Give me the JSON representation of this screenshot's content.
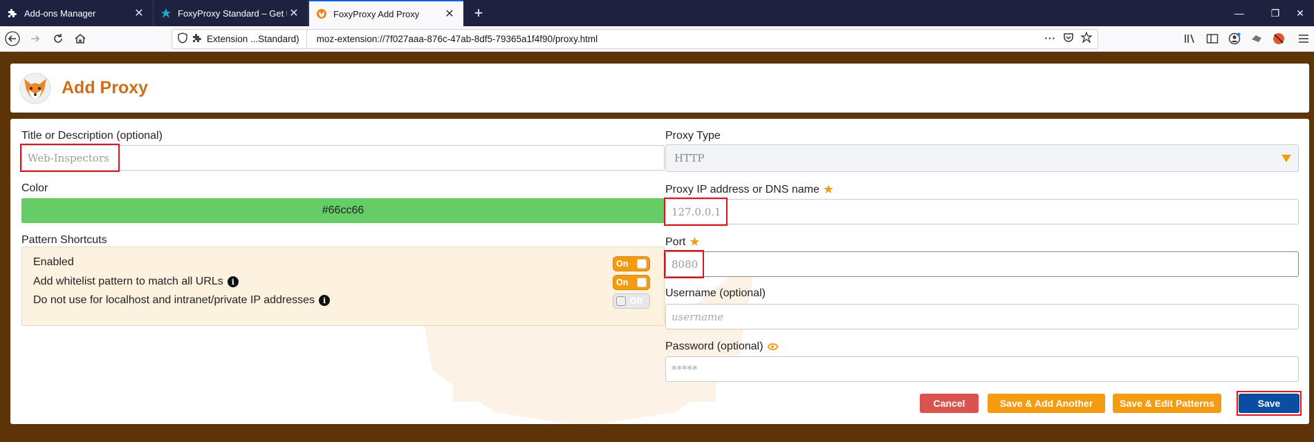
{
  "browser": {
    "tabs": [
      {
        "title": "Add-ons Manager",
        "icon": "puzzle-icon"
      },
      {
        "title": "FoxyProxy Standard – Get this E",
        "icon": "foxyproxy-star-icon"
      },
      {
        "title": "FoxyProxy Add Proxy",
        "icon": "foxyproxy-fox-icon",
        "active": true
      }
    ],
    "identity_label": "Extension ...Standard)",
    "url": "moz-extension://7f027aaa-876c-47ab-8df5-79365a1f4f90/proxy.html"
  },
  "page": {
    "title": "Add Proxy"
  },
  "form": {
    "title_label": "Title or Description (optional)",
    "title_value": "Web-Inspectors",
    "color_label": "Color",
    "color_value": "#66cc66",
    "pattern_label": "Pattern Shortcuts",
    "pattern_rows": [
      {
        "label": "Enabled",
        "state": "On",
        "info": false
      },
      {
        "label": "Add whitelist pattern to match all URLs",
        "state": "On",
        "info": true
      },
      {
        "label": "Do not use for localhost and intranet/private IP addresses",
        "state": "Off",
        "info": true
      }
    ],
    "proxy_type_label": "Proxy Type",
    "proxy_type_value": "HTTP",
    "ip_label": "Proxy IP address or DNS name",
    "ip_value": "127.0.0.1",
    "port_label": "Port",
    "port_value": "8080",
    "username_label": "Username (optional)",
    "username_placeholder": "username",
    "password_label": "Password (optional)",
    "password_placeholder": "*****"
  },
  "buttons": {
    "cancel": "Cancel",
    "save_add": "Save & Add Another",
    "save_edit": "Save & Edit Patterns",
    "save": "Save"
  },
  "colors": {
    "accent": "#f39c12",
    "brand_title": "#d06d16",
    "page_bg": "#5c3408",
    "save": "#0b4da2",
    "cancel": "#d9534f",
    "highlight": "#e3111b"
  }
}
